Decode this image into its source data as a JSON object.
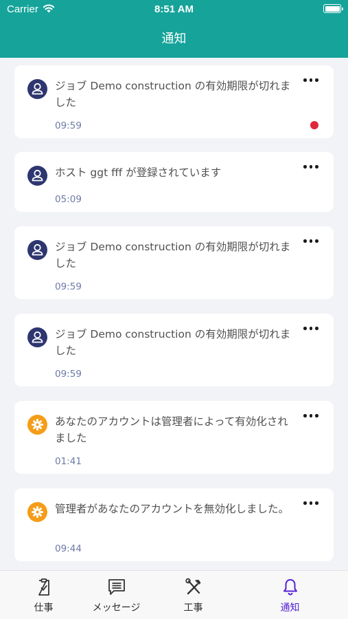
{
  "status_bar": {
    "carrier": "Carrier",
    "time": "8:51 AM"
  },
  "header": {
    "title": "通知"
  },
  "notifications": [
    {
      "icon": "user-icon",
      "message": "ジョブ Demo construction の有効期限が切れました",
      "time": "09:59",
      "unread": true
    },
    {
      "icon": "user-icon",
      "message": "ホスト ggt fff が登録されています",
      "time": "05:09",
      "unread": false
    },
    {
      "icon": "user-icon",
      "message": "ジョブ Demo construction の有効期限が切れました",
      "time": "09:59",
      "unread": false
    },
    {
      "icon": "user-icon",
      "message": "ジョブ Demo construction の有効期限が切れました",
      "time": "09:59",
      "unread": false
    },
    {
      "icon": "gear-icon",
      "message": "あなたのアカウントは管理者によって有効化されました",
      "time": "01:41",
      "unread": false
    },
    {
      "icon": "gear-icon",
      "message": "管理者があなたのアカウントを無効化しました。",
      "time": "09:44",
      "unread": false
    }
  ],
  "tabbar": {
    "tabs": [
      {
        "label": "仕事",
        "icon": "job-checklist-icon",
        "active": false
      },
      {
        "label": "メッセージ",
        "icon": "message-icon",
        "active": false
      },
      {
        "label": "工事",
        "icon": "tools-icon",
        "active": false
      },
      {
        "label": "通知",
        "icon": "bell-icon",
        "active": true
      }
    ]
  },
  "colors": {
    "header": "#16a39a",
    "active_tab": "#5322d6",
    "unread": "#e0283c",
    "user_icon": "#2e3670",
    "gear_icon": "#f59d18"
  }
}
